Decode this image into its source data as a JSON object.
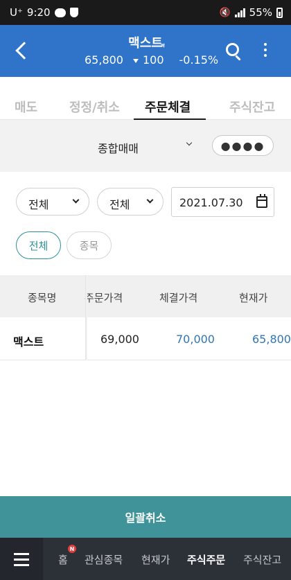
{
  "status_bar": {
    "carrier": "U⁺",
    "time": "9:20",
    "battery": "55%"
  },
  "header": {
    "stock_name": "맥스트",
    "price": "65,800",
    "change": "100",
    "change_pct": "-0.15%"
  },
  "tabs": [
    {
      "label": "매도"
    },
    {
      "label": "정정/취소"
    },
    {
      "label": "주문체결"
    },
    {
      "label": "주식잔고"
    }
  ],
  "account": {
    "name": "종합매매",
    "password_mask": "●●●●"
  },
  "filters": {
    "dropdown1": "전체",
    "dropdown2": "전체",
    "date": "2021.07.30",
    "pill_all": "전체",
    "pill_stock": "종목"
  },
  "table": {
    "headers": [
      "종목명",
      "주문가격",
      "체결가격",
      "현재가"
    ],
    "rows": [
      {
        "name": "맥스트",
        "order_price": "69,000",
        "exec_price": "70,000",
        "current_price": "65,800"
      }
    ]
  },
  "bulk_cancel_label": "일괄취소",
  "bottom_nav": {
    "items": [
      "홈",
      "관심종목",
      "현재가",
      "주식주문",
      "주식잔고"
    ],
    "badge": "N"
  },
  "colors": {
    "header_blue": "#2f74c8",
    "accent_teal": "#3f9399",
    "price_blue": "#2f76b8",
    "nav_dark": "#2c3138"
  }
}
